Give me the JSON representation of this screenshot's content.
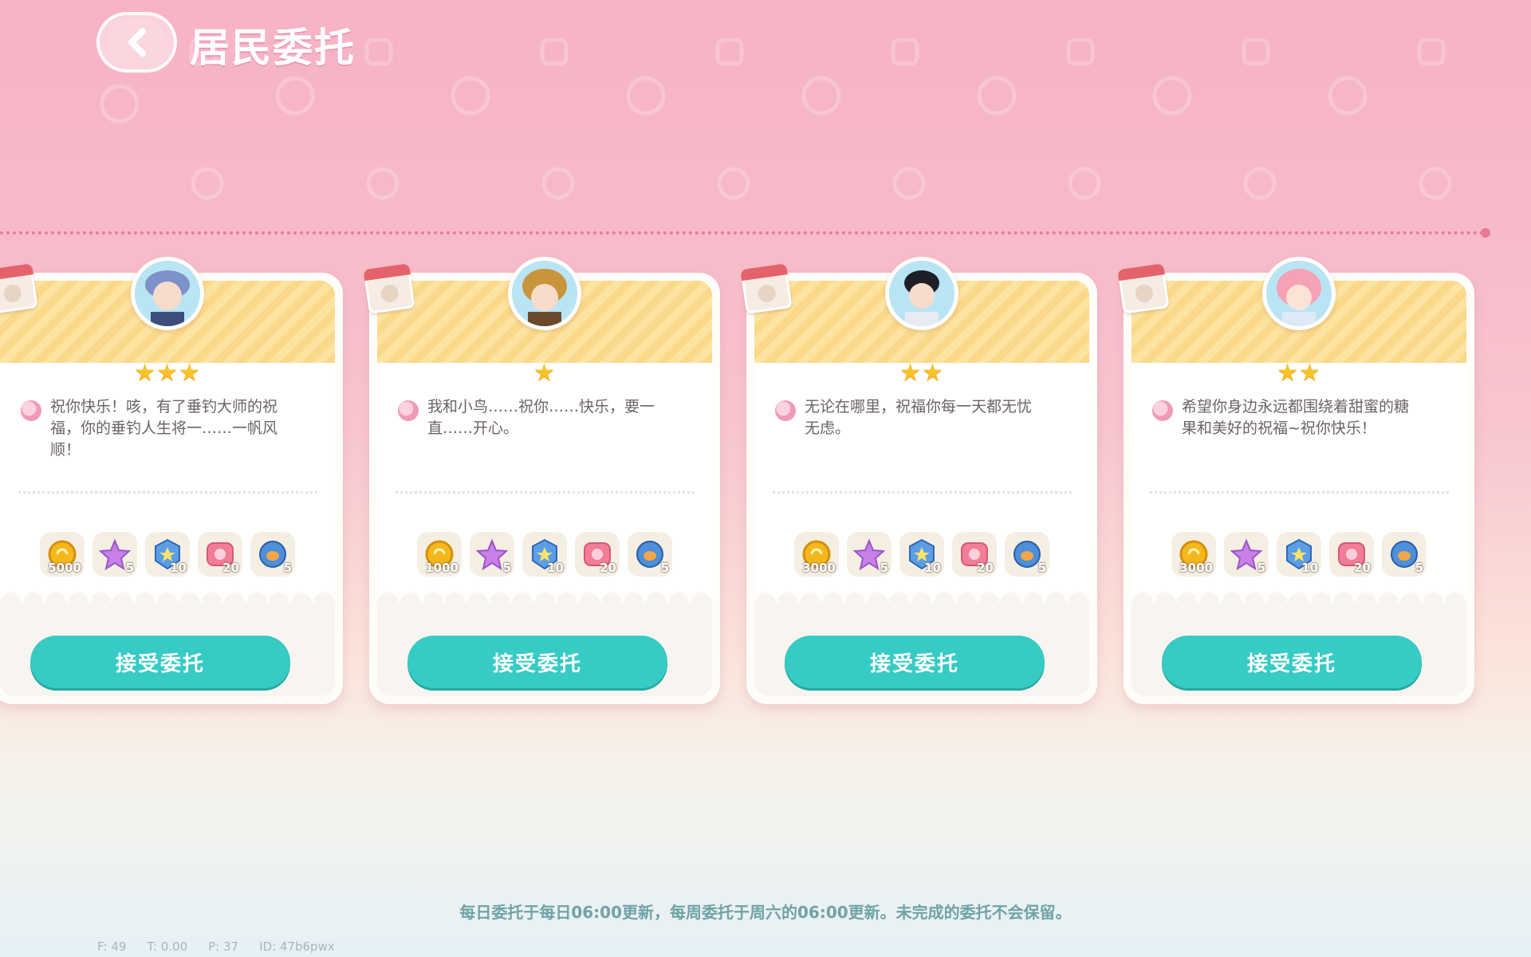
{
  "header": {
    "title": "居民委托"
  },
  "cards": [
    {
      "stars": "★★★",
      "text": "祝你快乐！咳，有了垂钓大师的祝福，你的垂钓人生将一……一帆风顺！",
      "rewards": [
        {
          "icon": "gold-coin-icon",
          "count": "5000"
        },
        {
          "icon": "purple-star-icon",
          "count": "5"
        },
        {
          "icon": "blue-badge-icon",
          "count": "10"
        },
        {
          "icon": "pink-ticket-icon",
          "count": "20"
        },
        {
          "icon": "blue-orb-icon",
          "count": "5"
        }
      ],
      "button": "接受委托"
    },
    {
      "stars": "★",
      "text": "我和小鸟……祝你……快乐，要一直……开心。",
      "rewards": [
        {
          "icon": "gold-coin-icon",
          "count": "1000"
        },
        {
          "icon": "purple-star-icon",
          "count": "5"
        },
        {
          "icon": "blue-badge-icon",
          "count": "10"
        },
        {
          "icon": "pink-ticket-icon",
          "count": "20"
        },
        {
          "icon": "blue-orb-icon",
          "count": "5"
        }
      ],
      "button": "接受委托"
    },
    {
      "stars": "★★",
      "text": "无论在哪里，祝福你每一天都无忧无虑。",
      "rewards": [
        {
          "icon": "gold-coin-icon",
          "count": "3000"
        },
        {
          "icon": "purple-star-icon",
          "count": "5"
        },
        {
          "icon": "blue-badge-icon",
          "count": "10"
        },
        {
          "icon": "pink-ticket-icon",
          "count": "20"
        },
        {
          "icon": "blue-orb-icon",
          "count": "5"
        }
      ],
      "button": "接受委托"
    },
    {
      "stars": "★★",
      "text": "希望你身边永远都围绕着甜蜜的糖果和美好的祝福~祝你快乐！",
      "rewards": [
        {
          "icon": "gold-coin-icon",
          "count": "3000"
        },
        {
          "icon": "purple-star-icon",
          "count": "5"
        },
        {
          "icon": "blue-badge-icon",
          "count": "10"
        },
        {
          "icon": "pink-ticket-icon",
          "count": "20"
        },
        {
          "icon": "blue-orb-icon",
          "count": "5"
        }
      ],
      "button": "接受委托"
    }
  ],
  "footer_note": "每日委托于每日06:00更新，每周委托于周六的06:00更新。未完成的委托不会保留。",
  "debug": {
    "f": "F: 49",
    "t": "T: 0.00",
    "p": "P: 37",
    "id": "ID: 47b6pwx"
  },
  "colors": {
    "accent": "#36cbc4",
    "banner": "#fbd98a",
    "star": "#f8c22b",
    "background_top": "#f6b3c6"
  }
}
